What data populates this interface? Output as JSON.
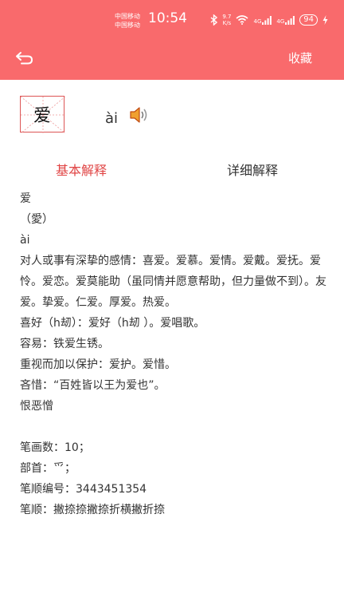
{
  "status_bar": {
    "carrier_line1": "中国移动",
    "carrier_line2": "中国移动",
    "time": "10:54",
    "net_speed_value": "9.7",
    "net_speed_unit": "K/s",
    "signal1_label": "4G",
    "signal2_label": "4G",
    "battery": "94"
  },
  "nav": {
    "favorite_label": "收藏"
  },
  "character": {
    "glyph": "爱",
    "pinyin": "ài"
  },
  "tabs": {
    "basic": "基本解释",
    "detailed": "详细解释"
  },
  "definition": {
    "lines": [
      "爱",
      "（愛）",
      "ài",
      "对人或事有深挚的感情：喜爱。爱慕。爱情。爱戴。爱抚。爱怜。爱恋。爱莫能助（虽同情并愿意帮助，但力量做不到）。友爱。挚爱。仁爱。厚爱。热爱。",
      "喜好（h刼）：爱好（h刼 ）。爱唱歌。",
      "容易：铁爱生锈。",
      "重视而加以保护：爱护。爱惜。",
      "吝惜：“百姓皆以王为爱也”。",
      "恨恶憎"
    ]
  },
  "meta": {
    "strokes": "笔画数：10；",
    "radical": "部首：爫；",
    "stroke_code": "笔顺编号：3443451354",
    "stroke_order": "笔顺：撇捺捺撇捺折横撇折捺"
  },
  "colors": {
    "header": "#f96a6c",
    "active_tab": "#e04545"
  }
}
